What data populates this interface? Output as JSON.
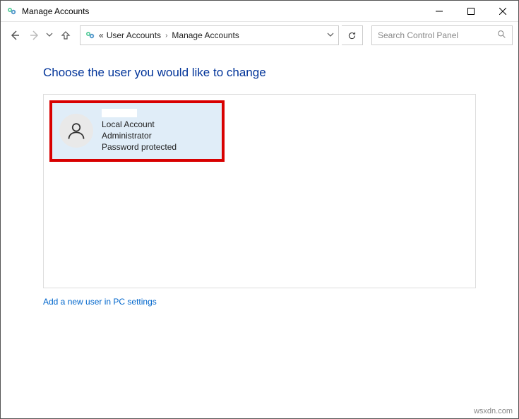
{
  "titlebar": {
    "title": "Manage Accounts"
  },
  "breadcrumb": {
    "prefix": "«",
    "part1": "User Accounts",
    "part2": "Manage Accounts"
  },
  "search": {
    "placeholder": "Search Control Panel"
  },
  "page": {
    "heading": "Choose the user you would like to change"
  },
  "account": {
    "type": "Local Account",
    "role": "Administrator",
    "pw": "Password protected"
  },
  "addlink": {
    "text": "Add a new user in PC settings"
  },
  "watermark": {
    "text": "wsxdn.com"
  }
}
